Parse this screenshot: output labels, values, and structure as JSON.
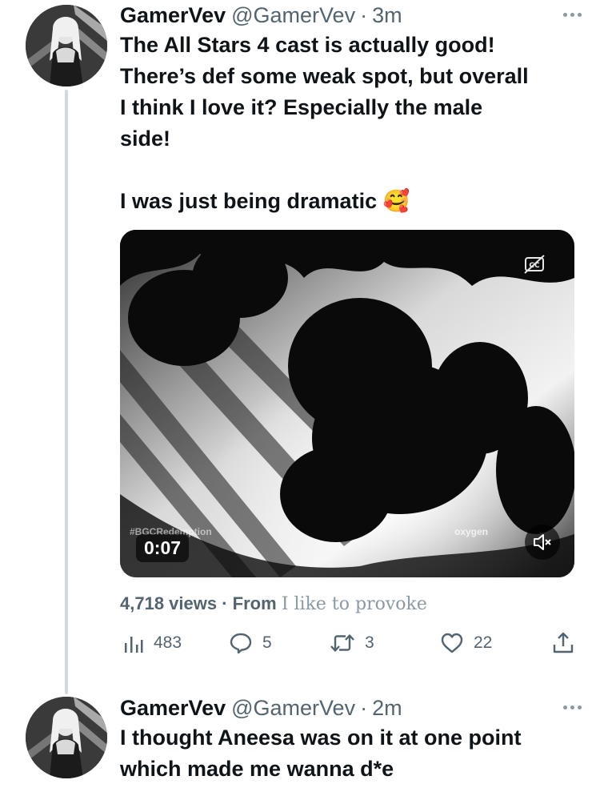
{
  "tweet1": {
    "display_name": "GamerVev",
    "handle": "@GamerVev",
    "separator": "·",
    "time": "3m",
    "text": "The All Stars 4 cast is actually good!\nThere’s def some weak spot, but overall\nI think I love it? Especially the male\nside!\n\nI was just being dramatic 🥰",
    "video": {
      "duration": "0:07",
      "watermark_left": "#BGCRedemption",
      "watermark_right": "oxygen"
    },
    "views_count": "4,718 views",
    "from_label": "· From",
    "source": "I like to provoke",
    "stats": {
      "analytics": "483",
      "replies": "5",
      "retweets": "3",
      "likes": "22"
    }
  },
  "tweet2": {
    "display_name": "GamerVev",
    "handle": "@GamerVev",
    "separator": "·",
    "time": "2m",
    "text": "I thought Aneesa was on it at one point\nwhich made me wanna d*e"
  },
  "icons": [
    "more-icon",
    "cc-icon",
    "mute-icon",
    "analytics-icon",
    "reply-icon",
    "retweet-icon",
    "like-icon",
    "share-icon"
  ]
}
